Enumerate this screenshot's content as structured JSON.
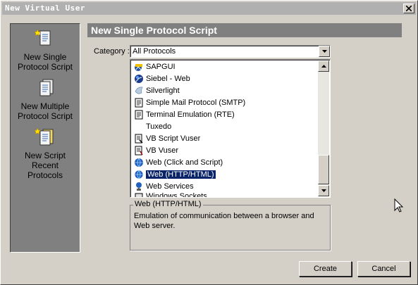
{
  "window": {
    "title": "New Virtual User"
  },
  "left_panel": {
    "items": [
      {
        "label_lines": [
          "New Single",
          "Protocol Script"
        ],
        "icon": "single-script-icon"
      },
      {
        "label_lines": [
          "New Multiple",
          "Protocol Script"
        ],
        "icon": "multiple-script-icon"
      },
      {
        "label_lines": [
          "New Script",
          "Recent",
          "Protocols"
        ],
        "icon": "recent-protocols-icon"
      }
    ]
  },
  "header": {
    "title": "New Single Protocol Script"
  },
  "category": {
    "label": "Category :",
    "value": "All Protocols"
  },
  "protocols": [
    {
      "label": "SAPGUI",
      "icon": "sapgui-icon"
    },
    {
      "label": "Siebel - Web",
      "icon": "siebel-icon"
    },
    {
      "label": "Silverlight",
      "icon": "silverlight-icon"
    },
    {
      "label": "Simple Mail Protocol (SMTP)",
      "icon": "smtp-icon"
    },
    {
      "label": "Terminal Emulation (RTE)",
      "icon": "terminal-icon"
    },
    {
      "label": "Tuxedo",
      "icon": "tuxedo-icon"
    },
    {
      "label": "VB Script Vuser",
      "icon": "vbscript-icon"
    },
    {
      "label": "VB Vuser",
      "icon": "vb-icon"
    },
    {
      "label": "Web (Click and Script)",
      "icon": "web-click-icon"
    },
    {
      "label": "Web (HTTP/HTML)",
      "icon": "web-http-icon",
      "selected": true
    },
    {
      "label": "Web Services",
      "icon": "web-services-icon"
    },
    {
      "label": "Windows Sockets",
      "icon": "windows-sockets-icon"
    }
  ],
  "description": {
    "title": "Web (HTTP/HTML)",
    "text": "Emulation of communication between a browser and Web server."
  },
  "buttons": {
    "create": "Create",
    "cancel": "Cancel"
  },
  "colors": {
    "selection": "#0a246a",
    "panel": "#808080",
    "face": "#d4d0c8"
  }
}
